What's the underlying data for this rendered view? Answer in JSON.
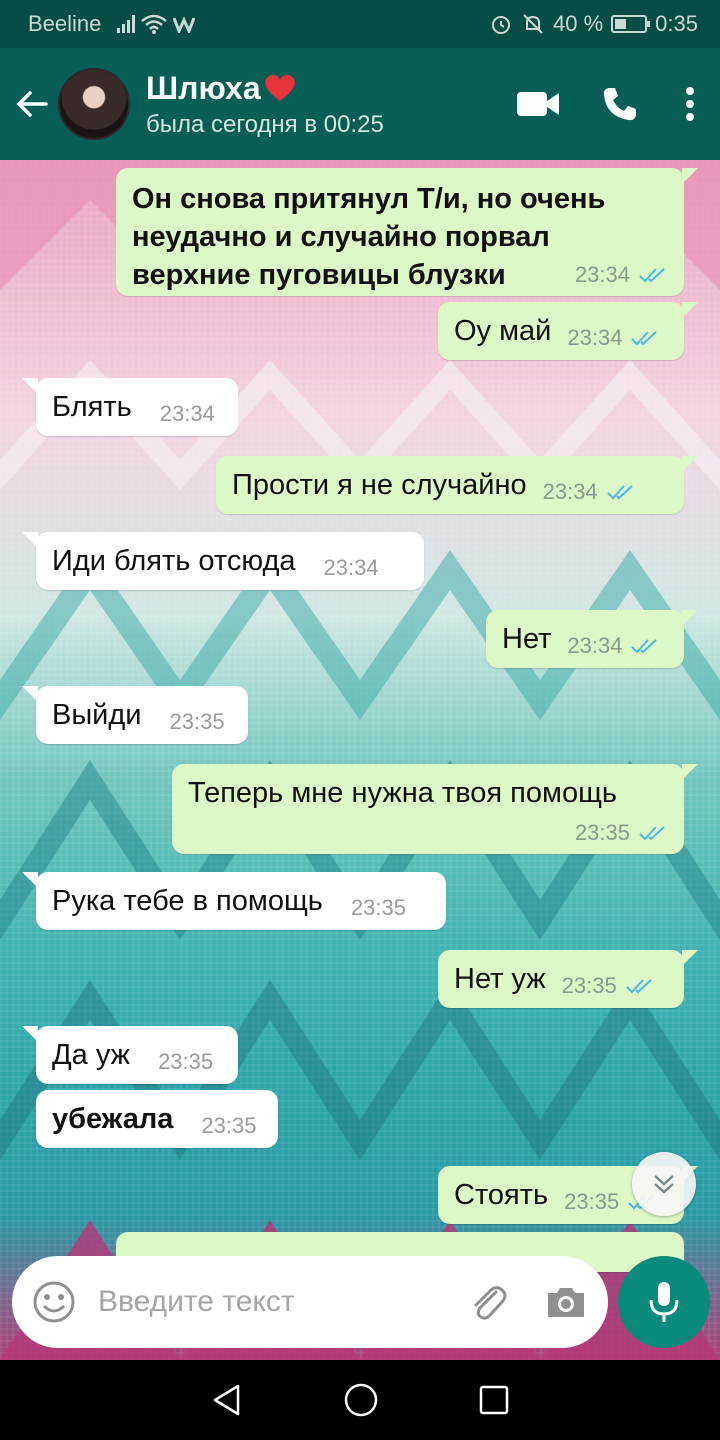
{
  "status_bar": {
    "carrier": "Beeline",
    "battery_pct": "40 %",
    "battery_level": 0.4,
    "time": "0:35"
  },
  "header": {
    "name": "Шлюха",
    "name_emoji": "❤️",
    "last_seen": "была сегодня в 00:25"
  },
  "messages": [
    {
      "dir": "out",
      "text": "Он снова притянул Т/и, но очень неудачно и случайно порвал верхние пуговицы блузки",
      "time": "23:34",
      "bold": true,
      "read": true
    },
    {
      "dir": "out",
      "text": "Оу май",
      "time": "23:34",
      "read": true
    },
    {
      "dir": "in",
      "text": "Блять",
      "time": "23:34"
    },
    {
      "dir": "out",
      "text": "Прости я не случайно",
      "time": "23:34",
      "read": true
    },
    {
      "dir": "in",
      "text": "Иди блять отсюда",
      "time": "23:34"
    },
    {
      "dir": "out",
      "text": "Нет",
      "time": "23:34",
      "read": true
    },
    {
      "dir": "in",
      "text": "Выйди",
      "time": "23:35"
    },
    {
      "dir": "out",
      "text": "Теперь мне нужна твоя помощь",
      "time": "23:35",
      "read": true
    },
    {
      "dir": "in",
      "text": "Рука тебе в помощь",
      "time": "23:35"
    },
    {
      "dir": "out",
      "text": "Нет уж",
      "time": "23:35",
      "read": true
    },
    {
      "dir": "in",
      "text": "Да уж",
      "time": "23:35"
    },
    {
      "dir": "in",
      "text": "убежала",
      "time": "23:35",
      "bold": true
    },
    {
      "dir": "out",
      "text": "Стоять",
      "time": "23:35",
      "read": true
    }
  ],
  "input": {
    "placeholder": "Введите текст"
  },
  "colors": {
    "header": "#075e54",
    "statusbar": "#054d44",
    "out_bubble": "#dcf8c6",
    "in_bubble": "#ffffff",
    "read_ticks": "#4fb6ec",
    "mic": "#0a8a7a"
  },
  "icons": [
    "back-arrow-icon",
    "video-call-icon",
    "phone-icon",
    "more-vert-icon",
    "double-check-icon",
    "emoji-icon",
    "attach-icon",
    "camera-icon",
    "mic-icon",
    "chevron-double-down-icon",
    "nav-back-icon",
    "nav-home-icon",
    "nav-recents-icon",
    "alarm-icon",
    "mute-icon",
    "wifi-icon",
    "signal-icon",
    "battery-icon"
  ]
}
